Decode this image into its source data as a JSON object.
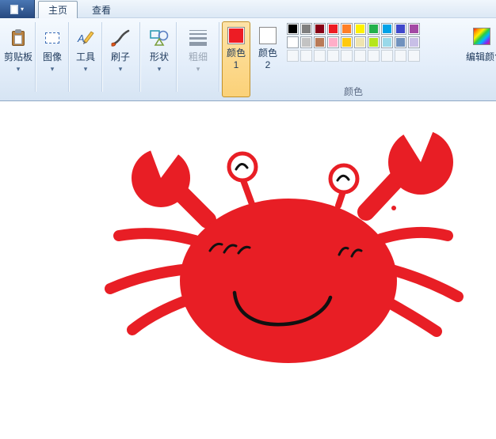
{
  "tabs": [
    {
      "label": "主页"
    },
    {
      "label": "查看"
    }
  ],
  "ribbon": {
    "groups": [
      {
        "label": "剪贴板"
      },
      {
        "label": "图像"
      },
      {
        "label": "工具"
      },
      {
        "label": "刷子"
      },
      {
        "label": "形状"
      },
      {
        "label": "粗细"
      }
    ],
    "color1_label": "颜色 1",
    "color2_label": "颜色 2",
    "edit_colors_label": "编辑颜色",
    "colors_group_label": "颜色"
  },
  "colors": {
    "color1": "#ed1c24",
    "color2": "#ffffff",
    "crab_red": "#e81e25",
    "palette_rows": [
      [
        "#000000",
        "#7f7f7f",
        "#880015",
        "#ed1c24",
        "#ff7f27",
        "#fff200",
        "#22b14c",
        "#00a2e8",
        "#3f48cc",
        "#a349a4"
      ],
      [
        "#ffffff",
        "#c3c3c3",
        "#b97a57",
        "#ffaec9",
        "#ffc90e",
        "#efe4b0",
        "#b5e61d",
        "#99d9ea",
        "#7092be",
        "#c8bfe7"
      ]
    ],
    "empty_slots": 10
  },
  "icons": {
    "dropdown_arrow": "▾"
  }
}
